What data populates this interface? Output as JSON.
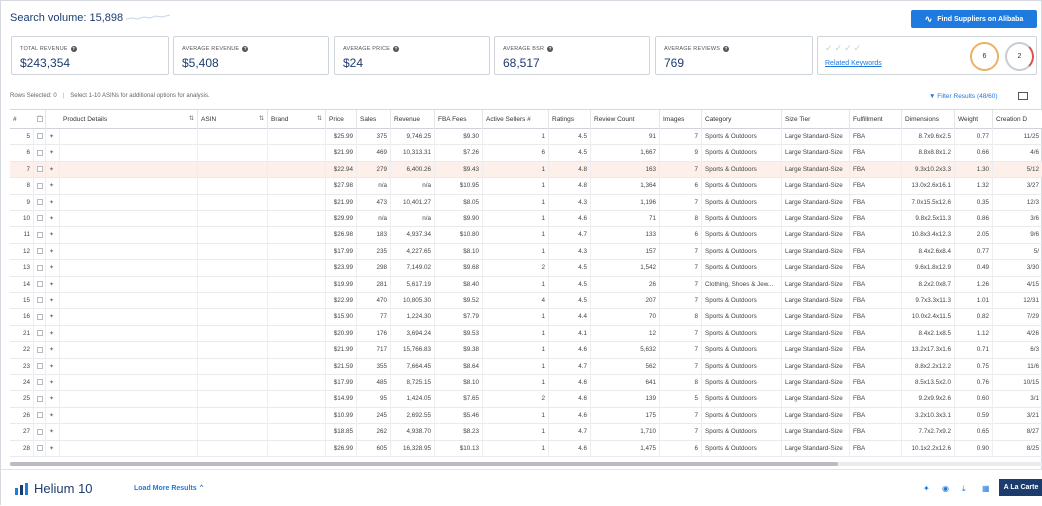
{
  "search_volume": {
    "label": "Search volume: 15,898"
  },
  "alibaba_button": "Find Suppliers on Alibaba",
  "stats": [
    {
      "label": "TOTAL REVENUE",
      "value": "$243,354"
    },
    {
      "label": "AVERAGE REVENUE",
      "value": "$5,408"
    },
    {
      "label": "AVERAGE PRICE",
      "value": "$24"
    },
    {
      "label": "AVERAGE BSR",
      "value": "68,517"
    },
    {
      "label": "AVERAGE REVIEWS",
      "value": "769"
    }
  ],
  "related": {
    "label": "Related Keywords",
    "ring1": "6",
    "ring2": "2"
  },
  "rows_selected": "Rows Selected: 0",
  "rows_hint": "Select 1-10 ASINs for additional options for analysis.",
  "filter_label": "Filter Results (48/60)",
  "columns": [
    "#",
    "Product Details",
    "ASIN",
    "Brand",
    "Price",
    "Sales",
    "Revenue",
    "FBA Fees",
    "Active Sellers #",
    "Ratings",
    "Review Count",
    "Images",
    "Category",
    "Size Tier",
    "Fulfillment",
    "Dimensions",
    "Weight",
    "Creation D"
  ],
  "rows": [
    {
      "n": "5",
      "price": "$25.99",
      "sales": "375",
      "rev": "9,746.25",
      "fba": "$9.30",
      "sellers": "1",
      "rating": "4.5",
      "reviews": "91",
      "images": "7",
      "cat": "Sports & Outdoors",
      "size": "Large Standard-Size",
      "ful": "FBA",
      "dim": "8.7x9.6x2.5",
      "wt": "0.77",
      "date": "11/25"
    },
    {
      "n": "6",
      "price": "$21.99",
      "sales": "469",
      "rev": "10,313.31",
      "fba": "$7.26",
      "sellers": "6",
      "rating": "4.5",
      "reviews": "1,667",
      "images": "9",
      "cat": "Sports & Outdoors",
      "size": "Large Standard-Size",
      "ful": "FBA",
      "dim": "8.8x8.8x1.2",
      "wt": "0.66",
      "date": "4/6"
    },
    {
      "n": "7",
      "price": "$22.94",
      "sales": "279",
      "rev": "6,400.26",
      "fba": "$9.43",
      "sellers": "1",
      "rating": "4.8",
      "reviews": "163",
      "images": "7",
      "cat": "Sports & Outdoors",
      "size": "Large Standard-Size",
      "ful": "FBA",
      "dim": "9.3x10.2x3.3",
      "wt": "1.30",
      "date": "5/12",
      "hl": true
    },
    {
      "n": "8",
      "price": "$27.98",
      "sales": "n/a",
      "rev": "n/a",
      "fba": "$10.95",
      "sellers": "1",
      "rating": "4.8",
      "reviews": "1,364",
      "images": "6",
      "cat": "Sports & Outdoors",
      "size": "Large Standard-Size",
      "ful": "FBA",
      "dim": "13.0x2.6x16.1",
      "wt": "1.32",
      "date": "3/27"
    },
    {
      "n": "9",
      "price": "$21.99",
      "sales": "473",
      "rev": "10,401.27",
      "fba": "$8.05",
      "sellers": "1",
      "rating": "4.3",
      "reviews": "1,196",
      "images": "7",
      "cat": "Sports & Outdoors",
      "size": "Large Standard-Size",
      "ful": "FBA",
      "dim": "7.0x15.5x12.6",
      "wt": "0.35",
      "date": "12/3"
    },
    {
      "n": "10",
      "price": "$29.99",
      "sales": "n/a",
      "rev": "n/a",
      "fba": "$9.90",
      "sellers": "1",
      "rating": "4.6",
      "reviews": "71",
      "images": "8",
      "cat": "Sports & Outdoors",
      "size": "Large Standard-Size",
      "ful": "FBA",
      "dim": "9.8x2.5x11.3",
      "wt": "0.86",
      "date": "3/6"
    },
    {
      "n": "11",
      "price": "$26.98",
      "sales": "183",
      "rev": "4,937.34",
      "fba": "$10.80",
      "sellers": "1",
      "rating": "4.7",
      "reviews": "133",
      "images": "6",
      "cat": "Sports & Outdoors",
      "size": "Large Standard-Size",
      "ful": "FBA",
      "dim": "10.8x3.4x12.3",
      "wt": "2.05",
      "date": "9/6"
    },
    {
      "n": "12",
      "price": "$17.99",
      "sales": "235",
      "rev": "4,227.65",
      "fba": "$8.10",
      "sellers": "1",
      "rating": "4.3",
      "reviews": "157",
      "images": "7",
      "cat": "Sports & Outdoors",
      "size": "Large Standard-Size",
      "ful": "FBA",
      "dim": "8.4x2.6x8.4",
      "wt": "0.77",
      "date": "5/"
    },
    {
      "n": "13",
      "price": "$23.99",
      "sales": "298",
      "rev": "7,149.02",
      "fba": "$9.68",
      "sellers": "2",
      "rating": "4.5",
      "reviews": "1,542",
      "images": "7",
      "cat": "Sports & Outdoors",
      "size": "Large Standard-Size",
      "ful": "FBA",
      "dim": "9.6x1.8x12.9",
      "wt": "0.49",
      "date": "3/30"
    },
    {
      "n": "14",
      "price": "$19.99",
      "sales": "281",
      "rev": "5,617.19",
      "fba": "$8.40",
      "sellers": "1",
      "rating": "4.5",
      "reviews": "26",
      "images": "7",
      "cat": "Clothing, Shoes & Jew...",
      "size": "Large Standard-Size",
      "ful": "FBA",
      "dim": "8.2x2.0x8.7",
      "wt": "1.26",
      "date": "4/15"
    },
    {
      "n": "15",
      "price": "$22.99",
      "sales": "470",
      "rev": "10,805.30",
      "fba": "$9.52",
      "sellers": "4",
      "rating": "4.5",
      "reviews": "207",
      "images": "7",
      "cat": "Sports & Outdoors",
      "size": "Large Standard-Size",
      "ful": "FBA",
      "dim": "9.7x3.3x11.3",
      "wt": "1.01",
      "date": "12/31"
    },
    {
      "n": "16",
      "price": "$15.90",
      "sales": "77",
      "rev": "1,224.30",
      "fba": "$7.79",
      "sellers": "1",
      "rating": "4.4",
      "reviews": "70",
      "images": "8",
      "cat": "Sports & Outdoors",
      "size": "Large Standard-Size",
      "ful": "FBA",
      "dim": "10.0x2.4x11.5",
      "wt": "0.82",
      "date": "7/29"
    },
    {
      "n": "21",
      "price": "$20.99",
      "sales": "176",
      "rev": "3,694.24",
      "fba": "$9.53",
      "sellers": "1",
      "rating": "4.1",
      "reviews": "12",
      "images": "7",
      "cat": "Sports & Outdoors",
      "size": "Large Standard-Size",
      "ful": "FBA",
      "dim": "8.4x2.1x8.5",
      "wt": "1.12",
      "date": "4/26"
    },
    {
      "n": "22",
      "price": "$21.99",
      "sales": "717",
      "rev": "15,766.83",
      "fba": "$9.38",
      "sellers": "1",
      "rating": "4.6",
      "reviews": "5,632",
      "images": "7",
      "cat": "Sports & Outdoors",
      "size": "Large Standard-Size",
      "ful": "FBA",
      "dim": "13.2x17.3x1.6",
      "wt": "0.71",
      "date": "6/3"
    },
    {
      "n": "23",
      "price": "$21.59",
      "sales": "355",
      "rev": "7,664.45",
      "fba": "$8.64",
      "sellers": "1",
      "rating": "4.7",
      "reviews": "562",
      "images": "7",
      "cat": "Sports & Outdoors",
      "size": "Large Standard-Size",
      "ful": "FBA",
      "dim": "8.8x2.2x12.2",
      "wt": "0.75",
      "date": "11/6"
    },
    {
      "n": "24",
      "price": "$17.99",
      "sales": "485",
      "rev": "8,725.15",
      "fba": "$8.10",
      "sellers": "1",
      "rating": "4.6",
      "reviews": "641",
      "images": "8",
      "cat": "Sports & Outdoors",
      "size": "Large Standard-Size",
      "ful": "FBA",
      "dim": "8.5x13.5x2.0",
      "wt": "0.76",
      "date": "10/15"
    },
    {
      "n": "25",
      "price": "$14.99",
      "sales": "95",
      "rev": "1,424.05",
      "fba": "$7.65",
      "sellers": "2",
      "rating": "4.6",
      "reviews": "139",
      "images": "5",
      "cat": "Sports & Outdoors",
      "size": "Large Standard-Size",
      "ful": "FBA",
      "dim": "9.2x9.9x2.6",
      "wt": "0.60",
      "date": "3/1"
    },
    {
      "n": "26",
      "price": "$10.99",
      "sales": "245",
      "rev": "2,692.55",
      "fba": "$5.46",
      "sellers": "1",
      "rating": "4.6",
      "reviews": "175",
      "images": "7",
      "cat": "Sports & Outdoors",
      "size": "Large Standard-Size",
      "ful": "FBA",
      "dim": "3.2x10.3x3.1",
      "wt": "0.59",
      "date": "3/21"
    },
    {
      "n": "27",
      "price": "$18.85",
      "sales": "262",
      "rev": "4,938.70",
      "fba": "$8.23",
      "sellers": "1",
      "rating": "4.7",
      "reviews": "1,710",
      "images": "7",
      "cat": "Sports & Outdoors",
      "size": "Large Standard-Size",
      "ful": "FBA",
      "dim": "7.7x2.7x9.2",
      "wt": "0.65",
      "date": "8/27"
    },
    {
      "n": "28",
      "price": "$26.99",
      "sales": "605",
      "rev": "16,328.95",
      "fba": "$10.13",
      "sellers": "1",
      "rating": "4.6",
      "reviews": "1,475",
      "images": "6",
      "cat": "Sports & Outdoors",
      "size": "Large Standard-Size",
      "ful": "FBA",
      "dim": "10.1x2.2x12.6",
      "wt": "0.90",
      "date": "8/25"
    }
  ],
  "footer": {
    "logo": "Helium 10",
    "load_more": "Load More Results",
    "plan": "A La Carte"
  }
}
